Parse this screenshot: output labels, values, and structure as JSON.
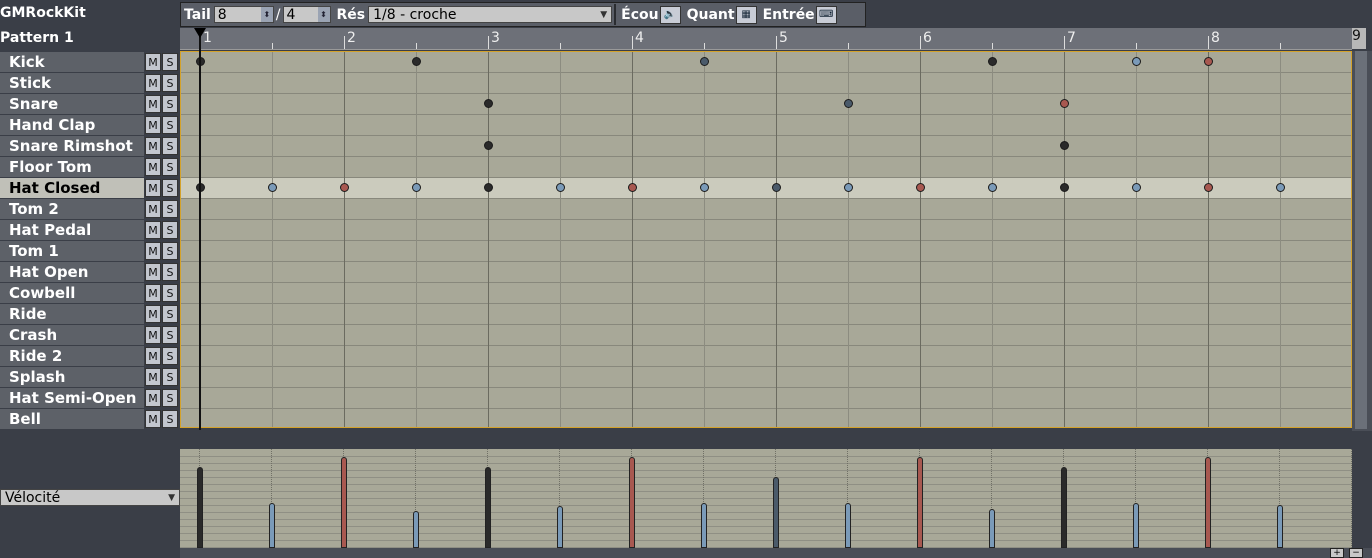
{
  "kit_name": "GMRockKit",
  "pattern_name": "Pattern 1",
  "toolbar": {
    "size_label": "Tail",
    "size_value": "8",
    "size_separator": "/",
    "size_denominator": "4",
    "resolution_label": "Rés",
    "resolution_value": "1/8 - croche",
    "listen_label": "Écou",
    "quantize_label": "Quant",
    "input_label": "Entrée"
  },
  "ruler": {
    "beats": [
      "1",
      "2",
      "3",
      "4",
      "5",
      "6",
      "7",
      "8"
    ],
    "end_label": "9"
  },
  "instruments": [
    {
      "name": "Kick"
    },
    {
      "name": "Stick"
    },
    {
      "name": "Snare"
    },
    {
      "name": "Hand Clap"
    },
    {
      "name": "Snare Rimshot"
    },
    {
      "name": "Floor Tom"
    },
    {
      "name": "Hat Closed",
      "selected": true
    },
    {
      "name": "Tom 2"
    },
    {
      "name": "Hat Pedal"
    },
    {
      "name": "Tom 1"
    },
    {
      "name": "Hat Open"
    },
    {
      "name": "Cowbell"
    },
    {
      "name": "Ride"
    },
    {
      "name": "Crash"
    },
    {
      "name": "Ride 2"
    },
    {
      "name": "Splash"
    },
    {
      "name": "Hat Semi-Open"
    },
    {
      "name": "Bell"
    }
  ],
  "mute_label": "M",
  "solo_label": "S",
  "note_colors": {
    "dark": "#2a2a2a",
    "blue": "#7a9ab8",
    "red": "#a85850",
    "slate": "#4a5a6a"
  },
  "notes": [
    {
      "row": 0,
      "beat": 1,
      "color": "dark"
    },
    {
      "row": 0,
      "beat": 2.5,
      "color": "dark"
    },
    {
      "row": 0,
      "beat": 4.5,
      "color": "slate"
    },
    {
      "row": 0,
      "beat": 6.5,
      "color": "dark"
    },
    {
      "row": 0,
      "beat": 7.5,
      "color": "blue"
    },
    {
      "row": 0,
      "beat": 8,
      "color": "red"
    },
    {
      "row": 2,
      "beat": 3,
      "color": "dark"
    },
    {
      "row": 2,
      "beat": 5.5,
      "color": "slate"
    },
    {
      "row": 2,
      "beat": 7,
      "color": "red"
    },
    {
      "row": 4,
      "beat": 3,
      "color": "dark"
    },
    {
      "row": 4,
      "beat": 7,
      "color": "dark"
    },
    {
      "row": 6,
      "beat": 1,
      "color": "dark"
    },
    {
      "row": 6,
      "beat": 1.5,
      "color": "blue"
    },
    {
      "row": 6,
      "beat": 2,
      "color": "red"
    },
    {
      "row": 6,
      "beat": 2.5,
      "color": "blue"
    },
    {
      "row": 6,
      "beat": 3,
      "color": "dark"
    },
    {
      "row": 6,
      "beat": 3.5,
      "color": "blue"
    },
    {
      "row": 6,
      "beat": 4,
      "color": "red"
    },
    {
      "row": 6,
      "beat": 4.5,
      "color": "blue"
    },
    {
      "row": 6,
      "beat": 5,
      "color": "slate"
    },
    {
      "row": 6,
      "beat": 5.5,
      "color": "blue"
    },
    {
      "row": 6,
      "beat": 6,
      "color": "red"
    },
    {
      "row": 6,
      "beat": 6.5,
      "color": "blue"
    },
    {
      "row": 6,
      "beat": 7,
      "color": "dark"
    },
    {
      "row": 6,
      "beat": 7.5,
      "color": "blue"
    },
    {
      "row": 6,
      "beat": 8,
      "color": "red"
    },
    {
      "row": 6,
      "beat": 8.5,
      "color": "blue"
    }
  ],
  "velocity_label": "Vélocité",
  "velocities": [
    {
      "beat": 1,
      "value": 0.82,
      "color": "dark"
    },
    {
      "beat": 1.5,
      "value": 0.45,
      "color": "blue"
    },
    {
      "beat": 2,
      "value": 0.92,
      "color": "red"
    },
    {
      "beat": 2.5,
      "value": 0.37,
      "color": "blue"
    },
    {
      "beat": 3,
      "value": 0.82,
      "color": "dark"
    },
    {
      "beat": 3.5,
      "value": 0.42,
      "color": "blue"
    },
    {
      "beat": 4,
      "value": 0.92,
      "color": "red"
    },
    {
      "beat": 4.5,
      "value": 0.45,
      "color": "blue"
    },
    {
      "beat": 5,
      "value": 0.72,
      "color": "slate"
    },
    {
      "beat": 5.5,
      "value": 0.45,
      "color": "blue"
    },
    {
      "beat": 6,
      "value": 0.92,
      "color": "red"
    },
    {
      "beat": 6.5,
      "value": 0.39,
      "color": "blue"
    },
    {
      "beat": 7,
      "value": 0.82,
      "color": "dark"
    },
    {
      "beat": 7.5,
      "value": 0.45,
      "color": "blue"
    },
    {
      "beat": 8,
      "value": 0.92,
      "color": "red"
    },
    {
      "beat": 8.5,
      "value": 0.43,
      "color": "blue"
    }
  ],
  "accent_color": "#d4a22a"
}
